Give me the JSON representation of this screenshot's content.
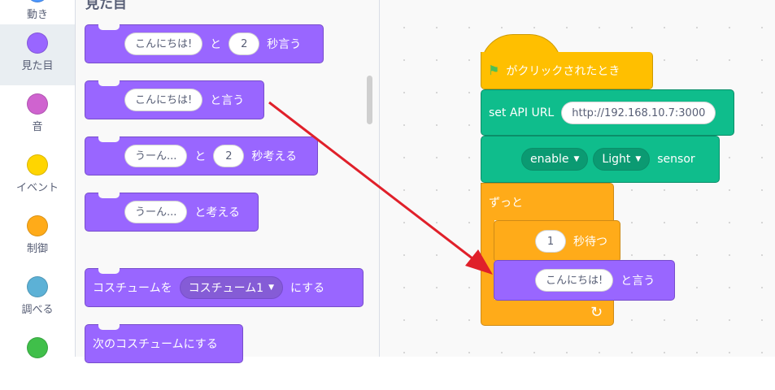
{
  "categories": [
    {
      "label": "動き",
      "color": "#4c97ff",
      "icon": "motion-dot-icon"
    },
    {
      "label": "見た目",
      "color": "#9966ff",
      "icon": "looks-dot-icon",
      "active": true
    },
    {
      "label": "音",
      "color": "#cf63cf",
      "icon": "sound-dot-icon"
    },
    {
      "label": "イベント",
      "color": "#ffd500",
      "icon": "events-dot-icon"
    },
    {
      "label": "制御",
      "color": "#ffab19",
      "icon": "control-dot-icon"
    },
    {
      "label": "調べる",
      "color": "#5cb1d6",
      "icon": "sensing-dot-icon"
    },
    {
      "label": "",
      "color": "#40bf4a",
      "icon": "operators-dot-icon"
    }
  ],
  "palette": {
    "title": "見た目",
    "blocks": {
      "say_for": {
        "text": "こんにちは!",
        "mid": "と",
        "secs": "2",
        "suffix": "秒言う"
      },
      "say": {
        "text": "こんにちは!",
        "suffix": "と言う"
      },
      "think_for": {
        "text": "うーん...",
        "mid": "と",
        "secs": "2",
        "suffix": "秒考える"
      },
      "think": {
        "text": "うーん...",
        "suffix": "と考える"
      },
      "switch_costume": {
        "prefix": "コスチュームを",
        "costume": "コスチューム1",
        "suffix": "にする"
      },
      "next_costume": {
        "label": "次のコスチュームにする"
      }
    }
  },
  "script": {
    "when_flag": {
      "label": "がクリックされたとき",
      "flag_icon": "green-flag-icon"
    },
    "set_api": {
      "label": "set API URL",
      "url": "http://192.168.10.7:3000"
    },
    "sensor": {
      "mode": "enable",
      "sensor_name": "Light",
      "suffix": "sensor"
    },
    "forever": {
      "label": "ずっと",
      "loop_icon": "loop-arrow-icon"
    },
    "wait": {
      "secs": "1",
      "suffix": "秒待つ"
    },
    "say": {
      "text": "こんにちは!",
      "suffix": "と言う"
    }
  },
  "annotation": {
    "arrow_color": "#e0202a",
    "icon": "red-arrow-icon"
  },
  "colors": {
    "looks": "#9966ff",
    "events": "#ffbf00",
    "control": "#ffab19",
    "extension": "#0fbd8c"
  }
}
